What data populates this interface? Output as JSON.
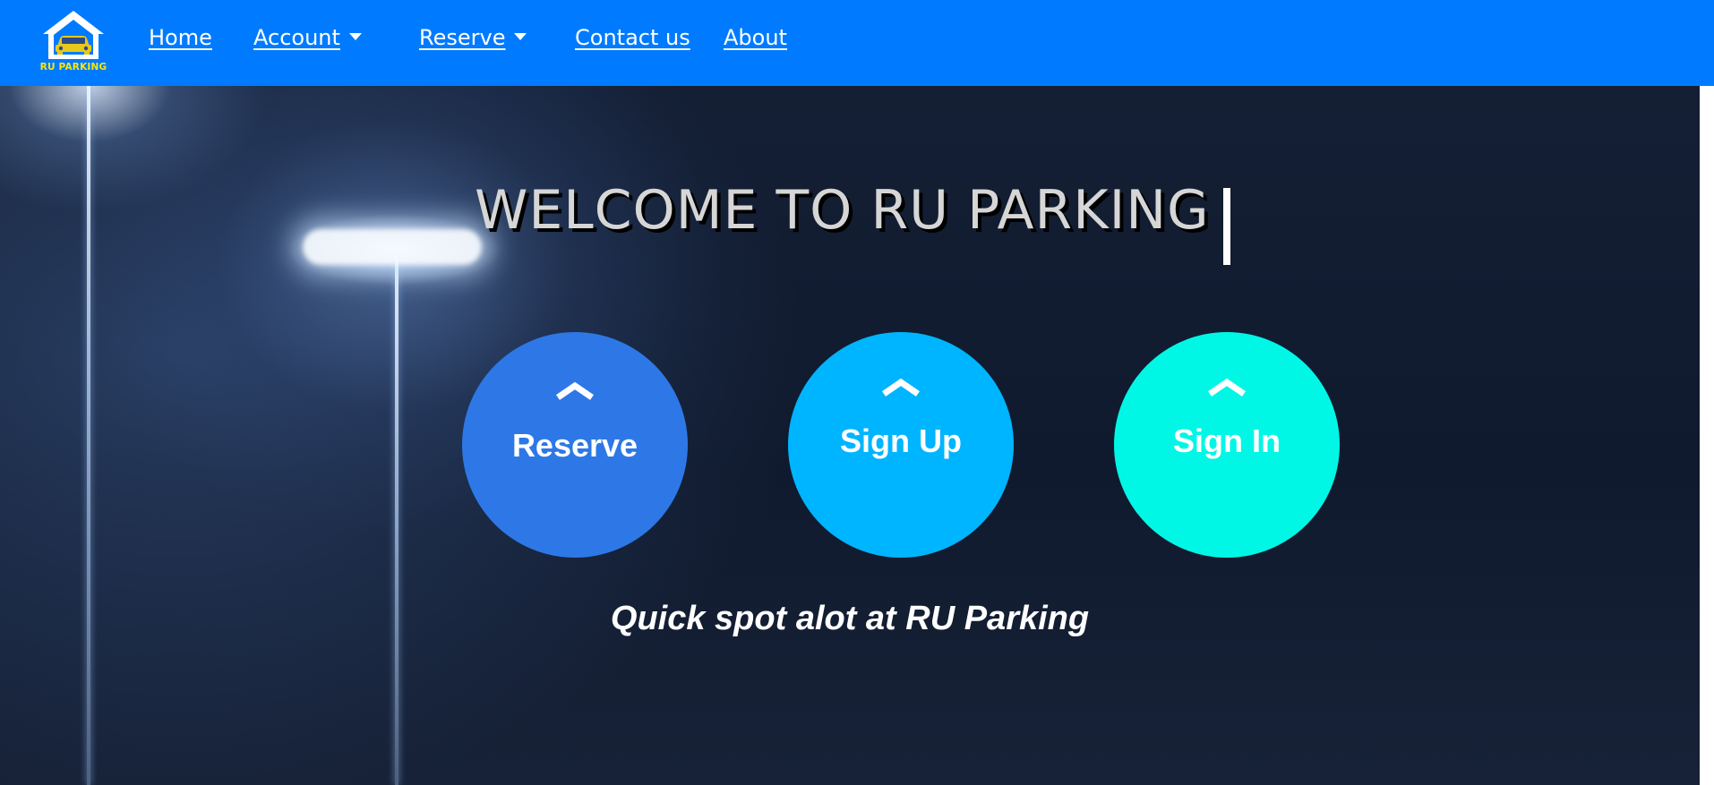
{
  "brand": {
    "logo_text": "RU PARKING",
    "logo_icon": "house-car-icon",
    "logo_color": "#ffe600"
  },
  "navbar": {
    "background": "#007bff",
    "links": [
      {
        "label": "Home",
        "has_dropdown": false
      },
      {
        "label": "Account",
        "has_dropdown": true
      },
      {
        "label": "Reserve",
        "has_dropdown": true
      },
      {
        "label": "Contact us",
        "has_dropdown": false
      },
      {
        "label": "About",
        "has_dropdown": false
      }
    ]
  },
  "hero": {
    "title": "WELCOME TO RU PARKING",
    "buttons": [
      {
        "label": "Reserve",
        "icon": "chevron-up-icon",
        "color": "#2d78e6"
      },
      {
        "label": "Sign Up",
        "icon": "chevron-up-icon",
        "color": "#00b5ff"
      },
      {
        "label": "Sign In",
        "icon": "chevron-up-icon",
        "color": "#00f7e6"
      }
    ],
    "tagline": "Quick spot alot at RU Parking"
  }
}
